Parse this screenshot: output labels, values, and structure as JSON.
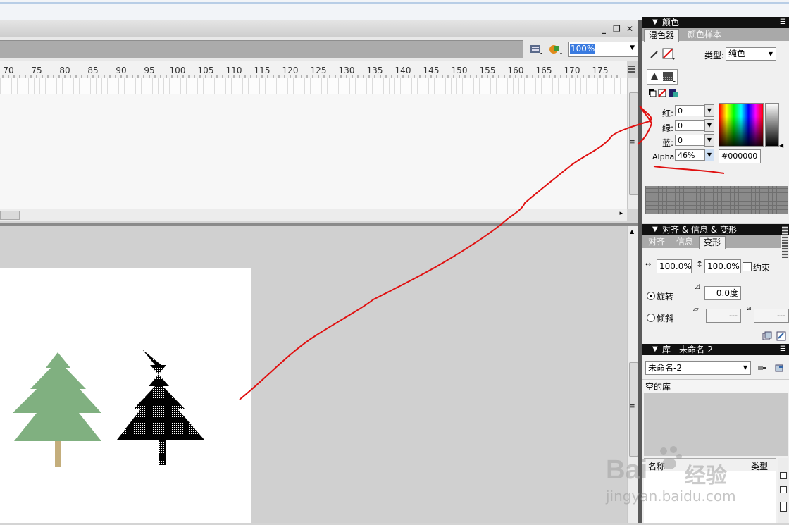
{
  "timeline": {
    "minimize": "_",
    "restore": "❐",
    "close": "✕",
    "zoom": "100%",
    "ruler_ticks": [
      "70",
      "75",
      "80",
      "85",
      "90",
      "95",
      "100",
      "105",
      "110",
      "115",
      "120",
      "125",
      "130",
      "135",
      "140",
      "145",
      "150",
      "155",
      "160",
      "165",
      "170",
      "175"
    ]
  },
  "color_panel": {
    "title": "颜色",
    "tabs": [
      "混色器",
      "颜色样本"
    ],
    "type_label": "类型:",
    "type_value": "纯色",
    "red_label": "红:",
    "red_value": "0",
    "green_label": "绿:",
    "green_value": "0",
    "blue_label": "蓝:",
    "blue_value": "0",
    "alpha_label": "Alpha:",
    "alpha_value": "46%",
    "hex_value": "#000000"
  },
  "align_panel": {
    "title": "对齐 & 信息 & 变形",
    "tabs": [
      "对齐",
      "信息",
      "变形"
    ],
    "width_value": "100.0%",
    "height_value": "100.0%",
    "constrain_label": "约束",
    "rotate_label": "旋转",
    "rotate_value": "0.0度",
    "skew_label": "倾斜",
    "skew_h_value": "---",
    "skew_v_value": "---"
  },
  "library_panel": {
    "title": "库 - 未命名-2",
    "doc_select": "未命名-2",
    "empty_label": "空的库",
    "col_name": "名称",
    "col_type": "类型"
  },
  "watermark": {
    "brand": "Bai",
    "brand_cn": "经验",
    "url": "jingyan.baidu.com"
  },
  "colors": {
    "tree_green": "#80b080",
    "trunk_tan": "#c4ae7c",
    "annotation_red": "#e01010",
    "selection_blue": "#3a7be0"
  }
}
